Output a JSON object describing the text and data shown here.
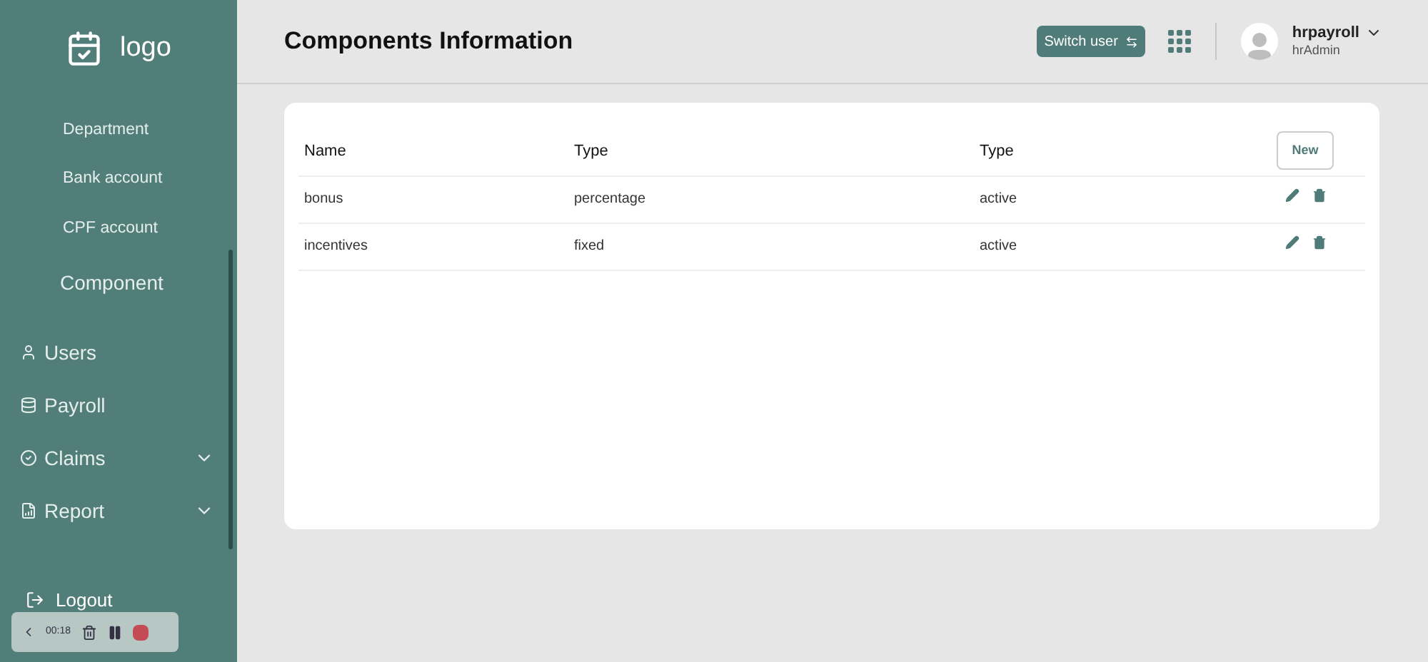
{
  "sidebar": {
    "logo": "logo",
    "sub_items": [
      {
        "label": "Department"
      },
      {
        "label": "Bank account"
      },
      {
        "label": "CPF account"
      },
      {
        "label": "Component"
      }
    ],
    "items": [
      {
        "label": "Users",
        "kind": "user",
        "expandable": false
      },
      {
        "label": "Payroll",
        "kind": "database",
        "expandable": false
      },
      {
        "label": "Claims",
        "kind": "check",
        "expandable": true
      },
      {
        "label": "Report",
        "kind": "report",
        "expandable": true
      }
    ],
    "logout": "Logout"
  },
  "header": {
    "title": "Components Information",
    "switch_user": "Switch user",
    "user_name": "hrpayroll",
    "user_role": "hrAdmin"
  },
  "table": {
    "new_button": "New",
    "columns": [
      "Name",
      "Type",
      "Type"
    ],
    "rows": [
      [
        "bonus",
        "percentage",
        "active"
      ],
      [
        "incentives",
        "fixed",
        "active"
      ]
    ]
  },
  "recorder": {
    "time": "00:18"
  }
}
